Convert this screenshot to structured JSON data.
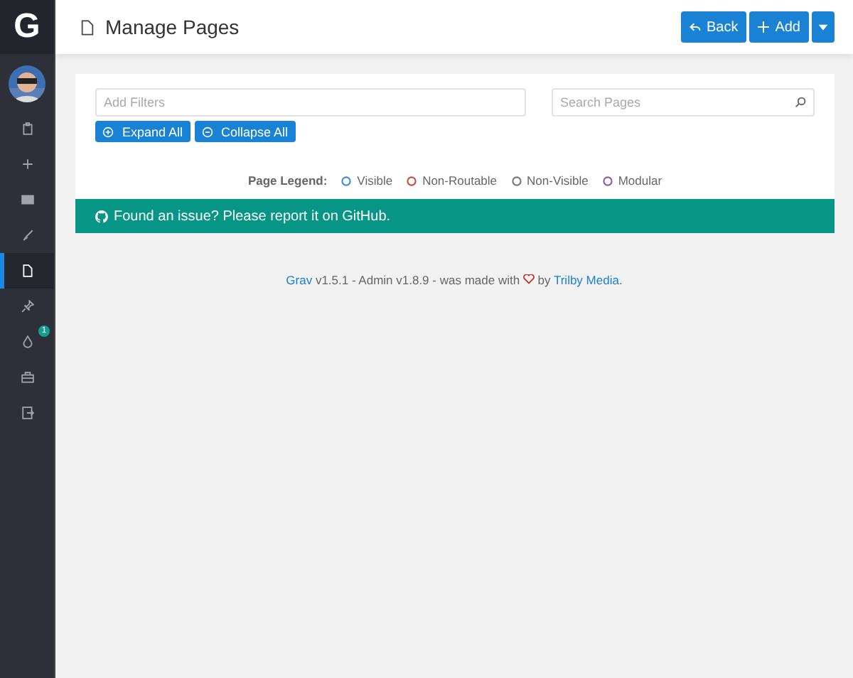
{
  "sidebar": {
    "logo": "G",
    "items": [
      {
        "selected": false
      },
      {
        "selected": false
      },
      {
        "selected": false
      },
      {
        "selected": false
      },
      {
        "selected": true
      },
      {
        "selected": false
      },
      {
        "selected": false,
        "badge": "1"
      },
      {
        "selected": false
      },
      {
        "selected": false
      }
    ]
  },
  "header": {
    "title": "Manage Pages",
    "buttons": [
      {
        "kind": "back",
        "label": "Back"
      },
      {
        "kind": "add",
        "label": "Add"
      },
      {
        "kind": "dropdown"
      }
    ]
  },
  "filters": {
    "placeholder": "Add Filters"
  },
  "search": {
    "placeholder": "Search Pages"
  },
  "actions": [
    {
      "kind": "expand",
      "label": "Expand All"
    },
    {
      "kind": "collapse",
      "label": "Collapse All"
    }
  ],
  "legend": {
    "title": "Page Legend:",
    "items": [
      {
        "label": "Visible",
        "color": "#3a8fd0"
      },
      {
        "label": "Non-Routable",
        "color": "#c0513f"
      },
      {
        "label": "Non-Visible",
        "color": "#777777"
      },
      {
        "label": "Modular",
        "color": "#8e55b5"
      }
    ]
  },
  "notice": "Found an issue? Please report it on GitHub.",
  "footer": [
    {
      "kind": "link",
      "text": "Grav"
    },
    {
      "kind": "text",
      "text": " v1.5.1 - Admin v1.8.9 - was made with "
    },
    {
      "kind": "heart"
    },
    {
      "kind": "text",
      "text": " by "
    },
    {
      "kind": "link",
      "text": "Trilby Media"
    },
    {
      "kind": "text",
      "text": "."
    }
  ]
}
